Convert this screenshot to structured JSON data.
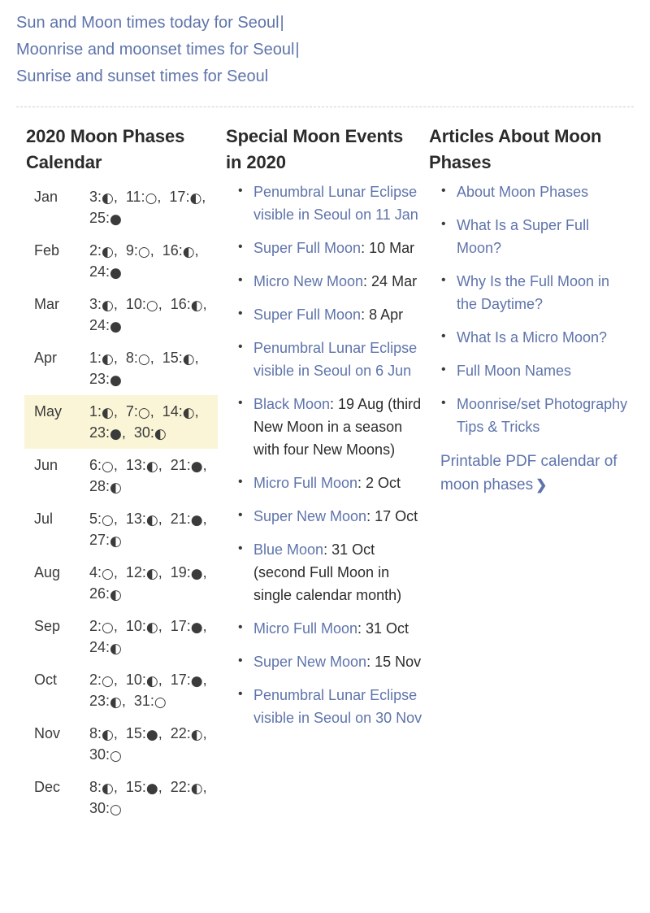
{
  "top_links": [
    {
      "label": "Sun and Moon times today for Seoul",
      "sep": "|"
    },
    {
      "label": "Moonrise and moonset times for Seoul",
      "sep": "|"
    },
    {
      "label": "Sunrise and sunset times for Seoul",
      "sep": ""
    }
  ],
  "calendar": {
    "heading": "2020 Moon Phases Calendar",
    "highlight_month": "May",
    "highlight_color": "#faf5d7",
    "phase_glyphs": {
      "quarter": "◐",
      "full": "○",
      "new": "●"
    },
    "rows": [
      {
        "month": "Jan",
        "entries": [
          {
            "day": "3",
            "phase": "quarter"
          },
          {
            "day": "11",
            "phase": "full"
          },
          {
            "day": "17",
            "phase": "quarter"
          },
          {
            "day": "25",
            "phase": "new"
          }
        ]
      },
      {
        "month": "Feb",
        "entries": [
          {
            "day": "2",
            "phase": "quarter"
          },
          {
            "day": "9",
            "phase": "full"
          },
          {
            "day": "16",
            "phase": "quarter"
          },
          {
            "day": "24",
            "phase": "new"
          }
        ]
      },
      {
        "month": "Mar",
        "entries": [
          {
            "day": "3",
            "phase": "quarter"
          },
          {
            "day": "10",
            "phase": "full"
          },
          {
            "day": "16",
            "phase": "quarter"
          },
          {
            "day": "24",
            "phase": "new"
          }
        ]
      },
      {
        "month": "Apr",
        "entries": [
          {
            "day": "1",
            "phase": "quarter"
          },
          {
            "day": "8",
            "phase": "full"
          },
          {
            "day": "15",
            "phase": "quarter"
          },
          {
            "day": "23",
            "phase": "new"
          }
        ]
      },
      {
        "month": "May",
        "entries": [
          {
            "day": "1",
            "phase": "quarter"
          },
          {
            "day": "7",
            "phase": "full"
          },
          {
            "day": "14",
            "phase": "quarter"
          },
          {
            "day": "23",
            "phase": "new"
          },
          {
            "day": "30",
            "phase": "quarter"
          }
        ]
      },
      {
        "month": "Jun",
        "entries": [
          {
            "day": "6",
            "phase": "full"
          },
          {
            "day": "13",
            "phase": "quarter"
          },
          {
            "day": "21",
            "phase": "new"
          },
          {
            "day": "28",
            "phase": "quarter"
          }
        ]
      },
      {
        "month": "Jul",
        "entries": [
          {
            "day": "5",
            "phase": "full"
          },
          {
            "day": "13",
            "phase": "quarter"
          },
          {
            "day": "21",
            "phase": "new"
          },
          {
            "day": "27",
            "phase": "quarter"
          }
        ]
      },
      {
        "month": "Aug",
        "entries": [
          {
            "day": "4",
            "phase": "full"
          },
          {
            "day": "12",
            "phase": "quarter"
          },
          {
            "day": "19",
            "phase": "new"
          },
          {
            "day": "26",
            "phase": "quarter"
          }
        ]
      },
      {
        "month": "Sep",
        "entries": [
          {
            "day": "2",
            "phase": "full"
          },
          {
            "day": "10",
            "phase": "quarter"
          },
          {
            "day": "17",
            "phase": "new"
          },
          {
            "day": "24",
            "phase": "quarter"
          }
        ]
      },
      {
        "month": "Oct",
        "entries": [
          {
            "day": "2",
            "phase": "full"
          },
          {
            "day": "10",
            "phase": "quarter"
          },
          {
            "day": "17",
            "phase": "new"
          },
          {
            "day": "23",
            "phase": "quarter"
          },
          {
            "day": "31",
            "phase": "full"
          }
        ]
      },
      {
        "month": "Nov",
        "entries": [
          {
            "day": "8",
            "phase": "quarter"
          },
          {
            "day": "15",
            "phase": "new"
          },
          {
            "day": "22",
            "phase": "quarter"
          },
          {
            "day": "30",
            "phase": "full"
          }
        ]
      },
      {
        "month": "Dec",
        "entries": [
          {
            "day": "8",
            "phase": "quarter"
          },
          {
            "day": "15",
            "phase": "new"
          },
          {
            "day": "22",
            "phase": "quarter"
          },
          {
            "day": "30",
            "phase": "full"
          }
        ]
      }
    ]
  },
  "events": {
    "heading": "Special Moon Events in 2020",
    "items": [
      {
        "link": "Penumbral Lunar Eclipse visible in Seoul on 11 Jan",
        "rest": ""
      },
      {
        "link": "Super Full Moon",
        "rest": ": 10 Mar"
      },
      {
        "link": "Micro New Moon",
        "rest": ": 24 Mar"
      },
      {
        "link": "Super Full Moon",
        "rest": ": 8 Apr"
      },
      {
        "link": "Penumbral Lunar Eclipse visible in Seoul on 6 Jun",
        "rest": ""
      },
      {
        "link": "Black Moon",
        "rest": ": 19 Aug (third New Moon in a season with four New Moons)"
      },
      {
        "link": "Micro Full Moon",
        "rest": ": 2 Oct"
      },
      {
        "link": "Super New Moon",
        "rest": ": 17 Oct"
      },
      {
        "link": "Blue Moon",
        "rest": ": 31 Oct (second Full Moon in single calendar month)"
      },
      {
        "link": "Micro Full Moon",
        "rest": ": 31 Oct"
      },
      {
        "link": "Super New Moon",
        "rest": ": 15 Nov"
      },
      {
        "link": "Penumbral Lunar Eclipse visible in Seoul on 30 Nov",
        "rest": ""
      }
    ]
  },
  "articles": {
    "heading": "Articles About Moon Phases",
    "items": [
      "About Moon Phases",
      "What Is a Super Full Moon?",
      "Why Is the Full Moon in the Daytime?",
      "What Is a Micro Moon?",
      "Full Moon Names",
      "Moonrise/set Photography Tips & Tricks"
    ],
    "pdf_link": "Printable PDF calendar of moon phases",
    "pdf_chevron": "❯"
  }
}
